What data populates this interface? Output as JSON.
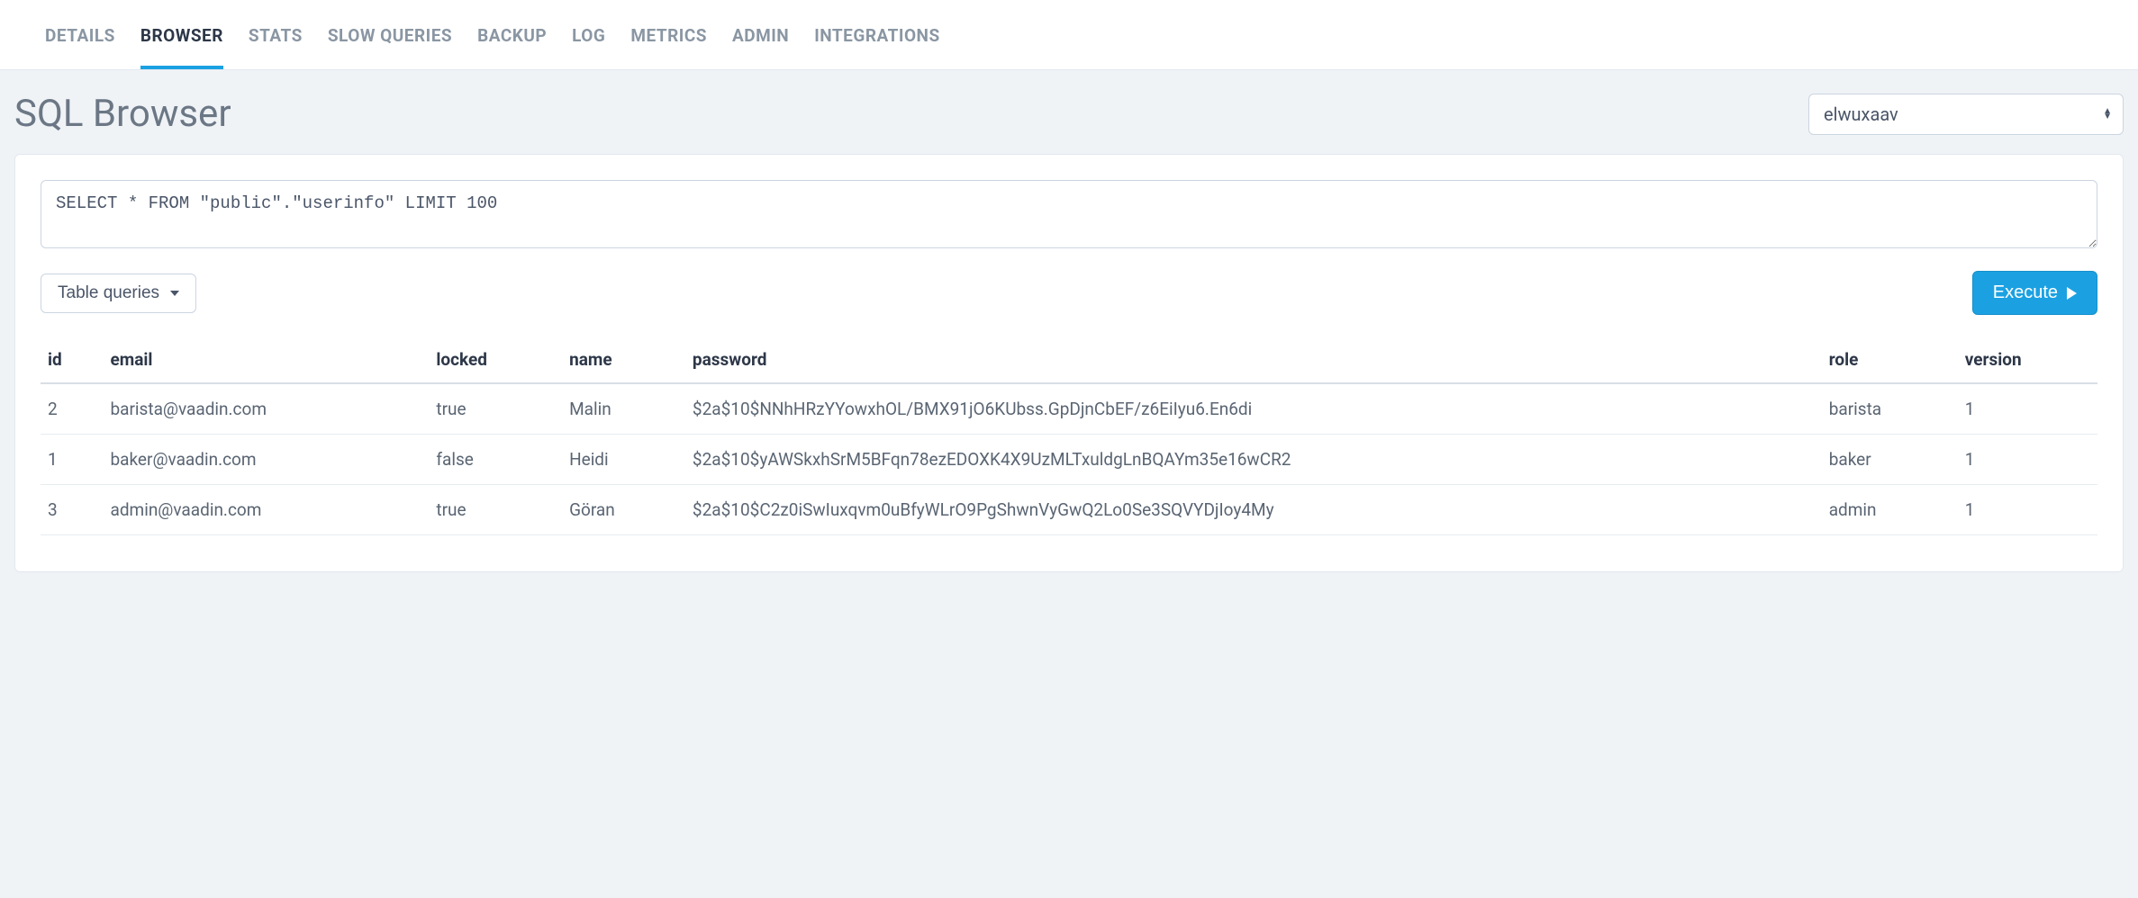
{
  "tabs": [
    {
      "label": "DETAILS",
      "active": false
    },
    {
      "label": "BROWSER",
      "active": true
    },
    {
      "label": "STATS",
      "active": false
    },
    {
      "label": "SLOW QUERIES",
      "active": false
    },
    {
      "label": "BACKUP",
      "active": false
    },
    {
      "label": "LOG",
      "active": false
    },
    {
      "label": "METRICS",
      "active": false
    },
    {
      "label": "ADMIN",
      "active": false
    },
    {
      "label": "INTEGRATIONS",
      "active": false
    }
  ],
  "page_title": "SQL Browser",
  "database_selector": {
    "selected": "elwuxaav"
  },
  "sql_query": "SELECT * FROM \"public\".\"userinfo\" LIMIT 100",
  "table_queries_label": "Table queries",
  "execute_label": "Execute",
  "results": {
    "columns": [
      "id",
      "email",
      "locked",
      "name",
      "password",
      "role",
      "version"
    ],
    "rows": [
      {
        "id": "2",
        "email": "barista@vaadin.com",
        "locked": "true",
        "name": "Malin",
        "password": "$2a$10$NNhHRzYYowxhOL/BMX91jO6KUbss.GpDjnCbEF/z6EiIyu6.En6di",
        "role": "barista",
        "version": "1"
      },
      {
        "id": "1",
        "email": "baker@vaadin.com",
        "locked": "false",
        "name": "Heidi",
        "password": "$2a$10$yAWSkxhSrM5BFqn78ezEDOXK4X9UzMLTxuldgLnBQAYm35e16wCR2",
        "role": "baker",
        "version": "1"
      },
      {
        "id": "3",
        "email": "admin@vaadin.com",
        "locked": "true",
        "name": "Göran",
        "password": "$2a$10$C2z0iSwIuxqvm0uBfyWLrO9PgShwnVyGwQ2Lo0Se3SQVYDjIoy4My",
        "role": "admin",
        "version": "1"
      }
    ]
  }
}
